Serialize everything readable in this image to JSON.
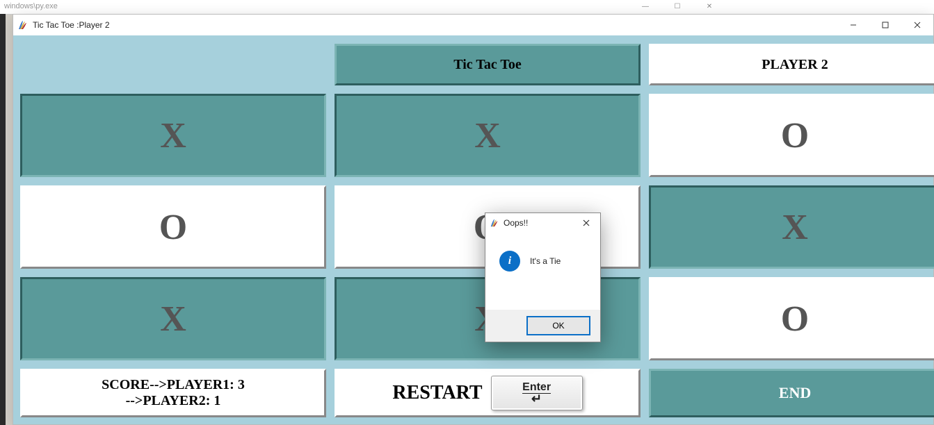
{
  "bg_window_title": "windows\\py.exe",
  "window": {
    "title": "Tic Tac Toe :Player 2"
  },
  "header": {
    "title_label": "Tic Tac Toe",
    "player_label": "PLAYER 2"
  },
  "board": {
    "cells": [
      "X",
      "X",
      "O",
      "O",
      "O",
      "X",
      "X",
      "X",
      "O"
    ],
    "pressed": [
      true,
      true,
      false,
      false,
      false,
      true,
      true,
      true,
      false
    ]
  },
  "footer": {
    "score_line1": "SCORE-->PLAYER1: 3",
    "score_line2": "-->PLAYER2: 1",
    "restart_label": "RESTART",
    "enter_key_label": "Enter",
    "end_label": "END"
  },
  "dialog": {
    "title": "Oops!!",
    "message": "It's a Tie",
    "ok_label": "OK"
  }
}
